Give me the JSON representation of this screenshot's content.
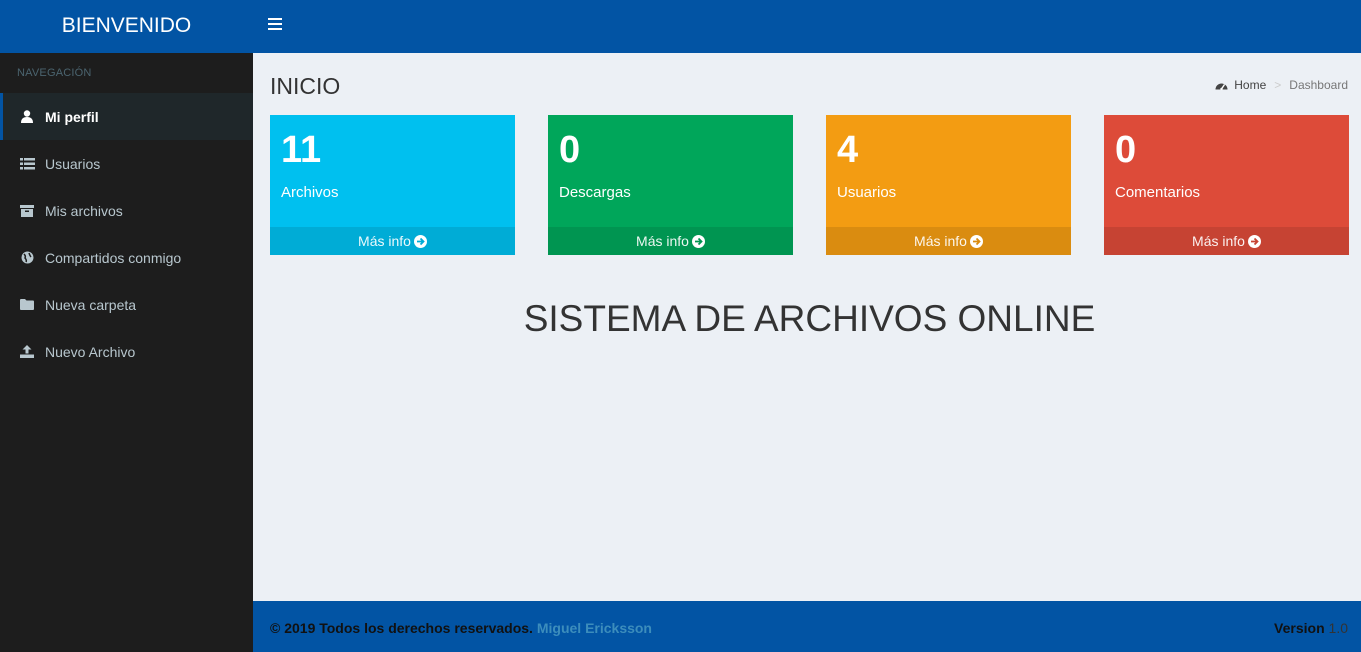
{
  "header": {
    "brand": "BIENVENIDO"
  },
  "sidebar": {
    "section": "NAVEGACIÓN",
    "items": [
      {
        "label": "Mi perfil",
        "icon": "user-icon"
      },
      {
        "label": "Usuarios",
        "icon": "list-icon"
      },
      {
        "label": "Mis archivos",
        "icon": "archive-icon"
      },
      {
        "label": "Compartidos conmigo",
        "icon": "globe-icon"
      },
      {
        "label": "Nueva carpeta",
        "icon": "folder-icon"
      },
      {
        "label": "Nuevo Archivo",
        "icon": "upload-icon"
      }
    ]
  },
  "main": {
    "title": "INICIO",
    "breadcrumb": {
      "home": "Home",
      "current": "Dashboard"
    },
    "boxes": [
      {
        "value": "11",
        "label": "Archivos",
        "link": "Más info",
        "color": "#00c0ef"
      },
      {
        "value": "0",
        "label": "Descargas",
        "link": "Más info",
        "color": "#00a65a"
      },
      {
        "value": "4",
        "label": "Usuarios",
        "link": "Más info",
        "color": "#f39c12"
      },
      {
        "value": "0",
        "label": "Comentarios",
        "link": "Más info",
        "color": "#dd4b39"
      }
    ],
    "headline": "SISTEMA DE ARCHIVOS ONLINE"
  },
  "footer": {
    "copyright": "© 2019 Todos los derechos reservados.",
    "author": "Miguel Ericksson",
    "version_label": "Version",
    "version": "1.0"
  },
  "colors": {
    "primary": "#0254a4",
    "sidebar": "#1d1d1d",
    "background": "#ecf0f5"
  }
}
